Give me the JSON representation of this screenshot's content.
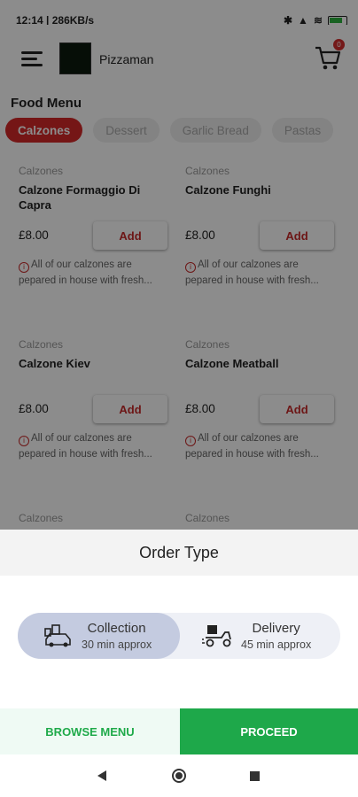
{
  "status": {
    "time_speed": "12:14 | 286KB/s",
    "battery": "56"
  },
  "app": {
    "title": "Pizzaman",
    "logo_text": "Pizzaman",
    "cart_count": "0"
  },
  "menu": {
    "title": "Food Menu",
    "categories": [
      "Calzones",
      "Dessert",
      "Garlic Bread",
      "Pastas"
    ],
    "active_category": "Calzones",
    "items": [
      {
        "category": "Calzones",
        "name": "Calzone Formaggio Di Capra",
        "price": "£8.00",
        "add_label": "Add",
        "desc": "All of our calzones are pepared in house with fresh..."
      },
      {
        "category": "Calzones",
        "name": "Calzone Funghi",
        "price": "£8.00",
        "add_label": "Add",
        "desc": "All of our calzones are pepared in house with fresh..."
      },
      {
        "category": "Calzones",
        "name": "Calzone Kiev",
        "price": "£8.00",
        "add_label": "Add",
        "desc": "All of our calzones are pepared in house with fresh..."
      },
      {
        "category": "Calzones",
        "name": "Calzone Meatball",
        "price": "£8.00",
        "add_label": "Add",
        "desc": "All of our calzones are pepared in house with fresh..."
      },
      {
        "category": "Calzones"
      },
      {
        "category": "Calzones"
      }
    ]
  },
  "order_type": {
    "title": "Order Type",
    "collection": {
      "label": "Collection",
      "time": "30 min approx",
      "selected": true
    },
    "delivery": {
      "label": "Delivery",
      "time": "45 min approx",
      "selected": false
    }
  },
  "actions": {
    "browse": "BROWSE MENU",
    "proceed": "PROCEED"
  },
  "colors": {
    "accent_red": "#d62828",
    "accent_green": "#1ea84a"
  }
}
